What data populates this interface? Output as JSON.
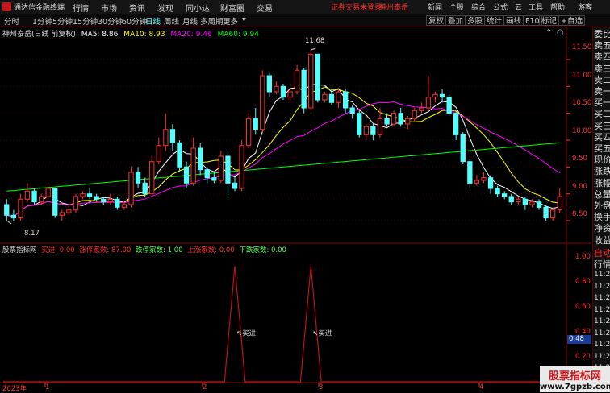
{
  "menubar": {
    "app_title": "通达信金融终端",
    "items": [
      "行情",
      "市场",
      "资讯",
      "发现",
      "同小达",
      "财富圈",
      "交易"
    ],
    "warning": "证券交易未登录",
    "broker": "神州泰岳",
    "right_items": [
      "新闻",
      "个股",
      "综合",
      "公式",
      "云",
      "工具",
      "帮助"
    ],
    "guest": "游客"
  },
  "toolbar": {
    "periods": [
      "分时",
      "1分钟",
      "5分钟",
      "15分钟",
      "30分钟",
      "60分钟",
      "日线",
      "周线",
      "月线",
      "多周期",
      "更多"
    ],
    "active": "日线",
    "right_buttons": [
      "复权",
      "叠加",
      "多股",
      "统计",
      "画线",
      "F10",
      "标记",
      "+自选"
    ]
  },
  "header": {
    "stock": "神州泰岳(日线 前复权)",
    "ma5": "MA5: 8.86",
    "ma10": "MA10: 8.93",
    "ma20": "MA20: 9.46",
    "ma60": "MA60: 9.94"
  },
  "price_axis": [
    "11.50",
    "11.00",
    "10.50",
    "10.00",
    "9.50",
    "9.00",
    "8.50"
  ],
  "price_high_label": "11.68",
  "price_low_label": "8.17",
  "indicator": {
    "name": "股票指标网",
    "buy": "买进: 0.00",
    "zhang_jia": "涨停家数: 87.00",
    "die_ting": "跌停家数: 1.00",
    "shang_zhang": "上涨家数: 0.00",
    "xia_die": "下跌家数: 0.00",
    "axis": [
      "1.00",
      "0.80",
      "0.60",
      "0.40",
      "0.20"
    ],
    "current": "0.48",
    "signal_label": "买进",
    "signal_marks": [
      "买进",
      "买进"
    ]
  },
  "date_axis": {
    "year": "2023年",
    "months": [
      "1",
      "2",
      "3",
      "4"
    ]
  },
  "right_panel": {
    "labels": [
      "委比",
      "卖五",
      "卖四",
      "卖三",
      "卖二",
      "卖一",
      "买一",
      "买二",
      "买三",
      "买四",
      "买五",
      "现价",
      "涨跌",
      "涨幅",
      "总量",
      "外盘",
      "换手",
      "净资",
      "收益"
    ],
    "tail_labels": [
      "自动",
      "行情"
    ],
    "times": [
      "11:26",
      "11:26",
      "11:26",
      "11:26",
      "11:26",
      "11:26",
      "11:26",
      "11:26",
      "11:26"
    ]
  },
  "watermark": {
    "title": "股票指标网",
    "url": "www.7gpzb.com"
  },
  "chart_data": {
    "type": "candlestick",
    "candles": [
      [
        8.8,
        8.6,
        8.9,
        8.5
      ],
      [
        8.6,
        8.55,
        8.7,
        8.5
      ],
      [
        8.55,
        8.9,
        9.0,
        8.5
      ],
      [
        8.9,
        9.05,
        9.2,
        8.85
      ],
      [
        9.05,
        8.85,
        9.1,
        8.8
      ],
      [
        8.85,
        8.95,
        9.0,
        8.8
      ],
      [
        8.95,
        9.1,
        9.15,
        8.9
      ],
      [
        9.1,
        8.6,
        9.1,
        8.55
      ],
      [
        8.6,
        8.65,
        8.7,
        8.5
      ],
      [
        8.65,
        8.7,
        8.75,
        8.6
      ],
      [
        8.7,
        8.95,
        9.0,
        8.65
      ],
      [
        8.95,
        9.0,
        9.05,
        8.9
      ],
      [
        9.0,
        8.95,
        9.1,
        8.9
      ],
      [
        8.95,
        8.9,
        9.0,
        8.85
      ],
      [
        8.9,
        8.85,
        8.95,
        8.8
      ],
      [
        8.85,
        8.9,
        9.0,
        8.8
      ],
      [
        8.9,
        8.75,
        8.95,
        8.7
      ],
      [
        8.75,
        8.8,
        8.85,
        8.7
      ],
      [
        8.8,
        9.4,
        9.5,
        8.75
      ],
      [
        9.4,
        9.2,
        9.5,
        9.1
      ],
      [
        9.2,
        9.0,
        9.3,
        8.95
      ],
      [
        9.0,
        9.6,
        9.7,
        9.0
      ],
      [
        9.6,
        9.9,
        10.05,
        9.55
      ],
      [
        9.9,
        10.2,
        10.5,
        9.8
      ],
      [
        10.2,
        9.95,
        10.3,
        9.8
      ],
      [
        9.95,
        9.5,
        10.0,
        9.4
      ],
      [
        9.5,
        9.2,
        9.6,
        9.1
      ],
      [
        9.2,
        9.85,
        10.05,
        9.15
      ],
      [
        9.85,
        9.45,
        9.95,
        9.35
      ],
      [
        9.45,
        9.3,
        9.5,
        9.2
      ],
      [
        9.3,
        9.25,
        9.4,
        9.2
      ],
      [
        9.25,
        9.7,
        9.8,
        9.2
      ],
      [
        9.7,
        9.2,
        9.75,
        8.95
      ],
      [
        9.2,
        9.1,
        9.3,
        9.05
      ],
      [
        9.1,
        9.9,
        10.0,
        9.05
      ],
      [
        9.9,
        10.4,
        10.5,
        9.85
      ],
      [
        10.4,
        10.2,
        10.6,
        10.1
      ],
      [
        10.2,
        11.2,
        11.3,
        10.15
      ],
      [
        11.2,
        10.9,
        11.25,
        10.8
      ],
      [
        10.9,
        11.0,
        11.1,
        10.85
      ],
      [
        11.0,
        10.8,
        11.05,
        10.75
      ],
      [
        10.8,
        10.9,
        10.95,
        10.7
      ],
      [
        10.9,
        11.3,
        11.4,
        10.85
      ],
      [
        11.3,
        10.6,
        11.35,
        10.5
      ],
      [
        10.6,
        11.6,
        11.68,
        10.55
      ],
      [
        11.6,
        10.75,
        11.6,
        10.7
      ],
      [
        10.75,
        10.85,
        10.9,
        10.7
      ],
      [
        10.85,
        10.7,
        10.95,
        10.65
      ],
      [
        10.7,
        10.9,
        10.95,
        10.6
      ],
      [
        10.9,
        10.6,
        10.95,
        10.5
      ],
      [
        10.6,
        10.5,
        10.65,
        10.4
      ],
      [
        10.5,
        10.1,
        10.55,
        10.05
      ],
      [
        10.1,
        10.25,
        10.3,
        10.0
      ],
      [
        10.25,
        10.1,
        10.3,
        10.0
      ],
      [
        10.1,
        10.4,
        10.6,
        10.05
      ],
      [
        10.4,
        10.3,
        10.5,
        10.25
      ],
      [
        10.3,
        10.5,
        10.55,
        10.25
      ],
      [
        10.5,
        10.3,
        10.6,
        10.25
      ],
      [
        10.3,
        10.4,
        10.45,
        10.2
      ],
      [
        10.4,
        10.55,
        10.6,
        10.35
      ],
      [
        10.55,
        10.6,
        10.7,
        10.5
      ],
      [
        10.6,
        10.8,
        11.2,
        10.55
      ],
      [
        10.8,
        10.85,
        10.9,
        10.7
      ],
      [
        10.85,
        10.8,
        10.95,
        10.7
      ],
      [
        10.8,
        10.5,
        10.85,
        10.45
      ],
      [
        10.5,
        10.1,
        10.55,
        10.0
      ],
      [
        10.1,
        9.6,
        10.15,
        9.55
      ],
      [
        9.6,
        9.2,
        9.65,
        9.1
      ],
      [
        9.2,
        9.25,
        9.35,
        9.15
      ],
      [
        9.25,
        9.3,
        9.4,
        9.2
      ],
      [
        9.3,
        9.1,
        9.35,
        9.0
      ],
      [
        9.1,
        9.0,
        9.15,
        8.95
      ],
      [
        9.0,
        8.95,
        9.05,
        8.9
      ],
      [
        8.95,
        8.85,
        9.0,
        8.8
      ],
      [
        8.85,
        8.9,
        8.95,
        8.8
      ],
      [
        8.9,
        8.8,
        8.95,
        8.7
      ],
      [
        8.8,
        8.85,
        8.9,
        8.75
      ],
      [
        8.85,
        8.75,
        8.9,
        8.7
      ],
      [
        8.75,
        8.55,
        8.8,
        8.5
      ],
      [
        8.55,
        8.7,
        8.75,
        8.5
      ],
      [
        8.7,
        8.95,
        9.1,
        8.65
      ]
    ],
    "ma_colors": {
      "ma5": "#ffffff",
      "ma10": "#ffff00",
      "ma20": "#ff00ff",
      "ma60": "#00ff00"
    },
    "ylim": [
      8.2,
      11.8
    ],
    "indicator_series": {
      "spike_indices": [
        33,
        44
      ],
      "ylim": [
        0,
        1.1
      ]
    },
    "up_color": "#ff3030",
    "down_color": "#54ffff"
  }
}
